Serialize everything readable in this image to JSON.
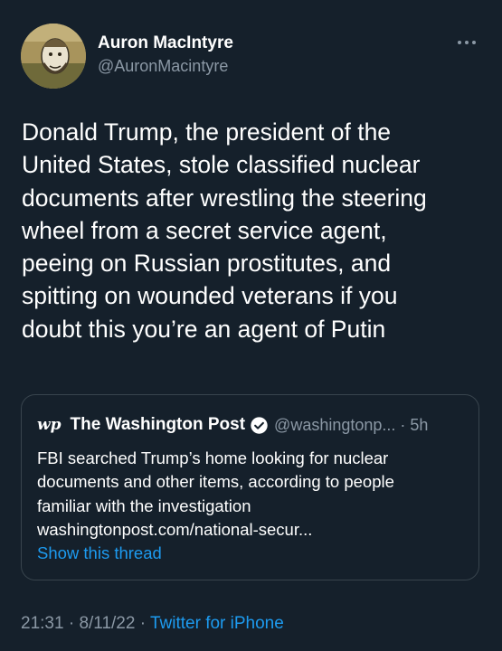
{
  "author": {
    "display_name": "Auron MacIntyre",
    "handle": "@AuronMacintyre"
  },
  "tweet": {
    "text": "Donald Trump, the president of the\nUnited States, stole classified nuclear\ndocuments after wrestling the steering\nwheel from a secret service agent,\npeeing on Russian prostitutes, and\nspitting on wounded veterans if you\ndoubt this you’re an agent of Putin"
  },
  "quoted": {
    "logo_text": "wp",
    "name": "The Washington Post",
    "handle": "@washingtonp...",
    "separator": "·",
    "time": "5h",
    "text_line1": "FBI searched Trump’s home looking for nuclear",
    "text_line2": "documents and other items, according to people",
    "text_line3": "familiar with the investigation",
    "url": "washingtonpost.com/national-secur...",
    "show_thread": "Show this thread"
  },
  "footer": {
    "time": "21:31",
    "dot1": "·",
    "date": "8/11/22",
    "dot2": "·",
    "source": "Twitter for iPhone"
  },
  "colors": {
    "background": "#15202b",
    "secondary_text": "#8b98a5",
    "link": "#1d9bf0",
    "border": "#38444d"
  },
  "icons": {
    "more": "more-icon",
    "verified": "verified-badge-icon"
  }
}
